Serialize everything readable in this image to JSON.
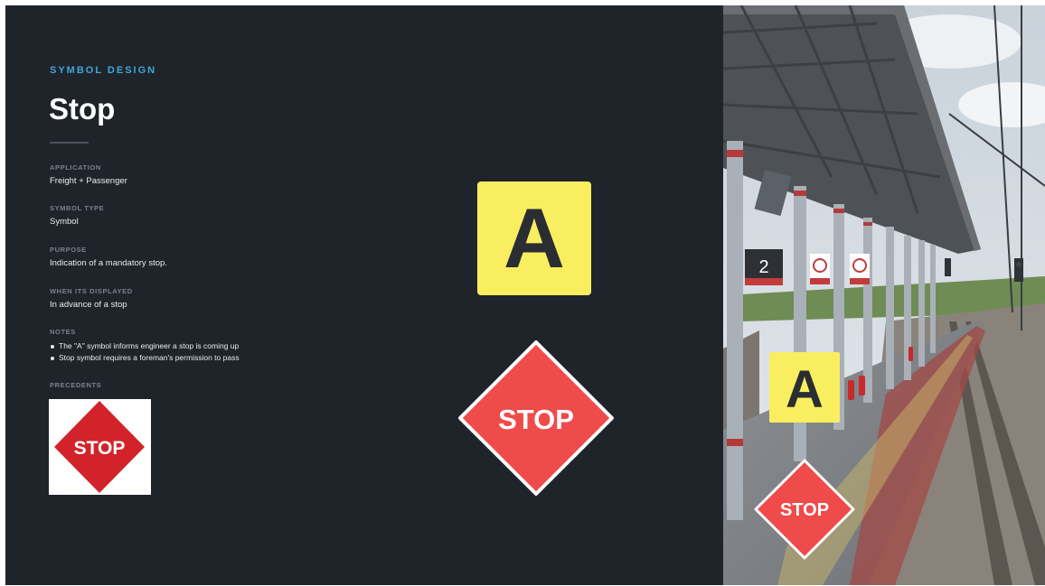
{
  "header": {
    "eyebrow": "SYMBOL DESIGN",
    "title": "Stop"
  },
  "fields": [
    {
      "label": "APPLICATION",
      "value": "Freight + Passenger"
    },
    {
      "label": "SYMBOL TYPE",
      "value": "Symbol"
    },
    {
      "label": "PURPOSE",
      "value": "Indication of a mandatory stop."
    },
    {
      "label": "WHEN ITS DISPLAYED",
      "value": "In advance of a stop"
    }
  ],
  "notes": {
    "label": "NOTES",
    "items": [
      "The \"A\" symbol informs engineer a stop is coming up",
      "Stop symbol requires a foreman's permission to pass"
    ]
  },
  "precedents": {
    "label": "PRECEDENTS",
    "sign_text": "STOP"
  },
  "symbols": {
    "a_sign": {
      "letter": "A",
      "background": "#f9ee5f",
      "letter_color": "#2a2d31"
    },
    "stop_sign": {
      "text": "STOP",
      "fill": "#ef4b4b",
      "border": "#ffffff"
    }
  },
  "photo": {
    "platform_number": "2",
    "a_sign_letter": "A",
    "stop_sign_text": "STOP"
  },
  "colors": {
    "background": "#1f242b",
    "accent": "#3fa7d6",
    "stop_red": "#ef4b4b",
    "precedent_red": "#d2232a",
    "a_yellow": "#f9ee5f"
  }
}
